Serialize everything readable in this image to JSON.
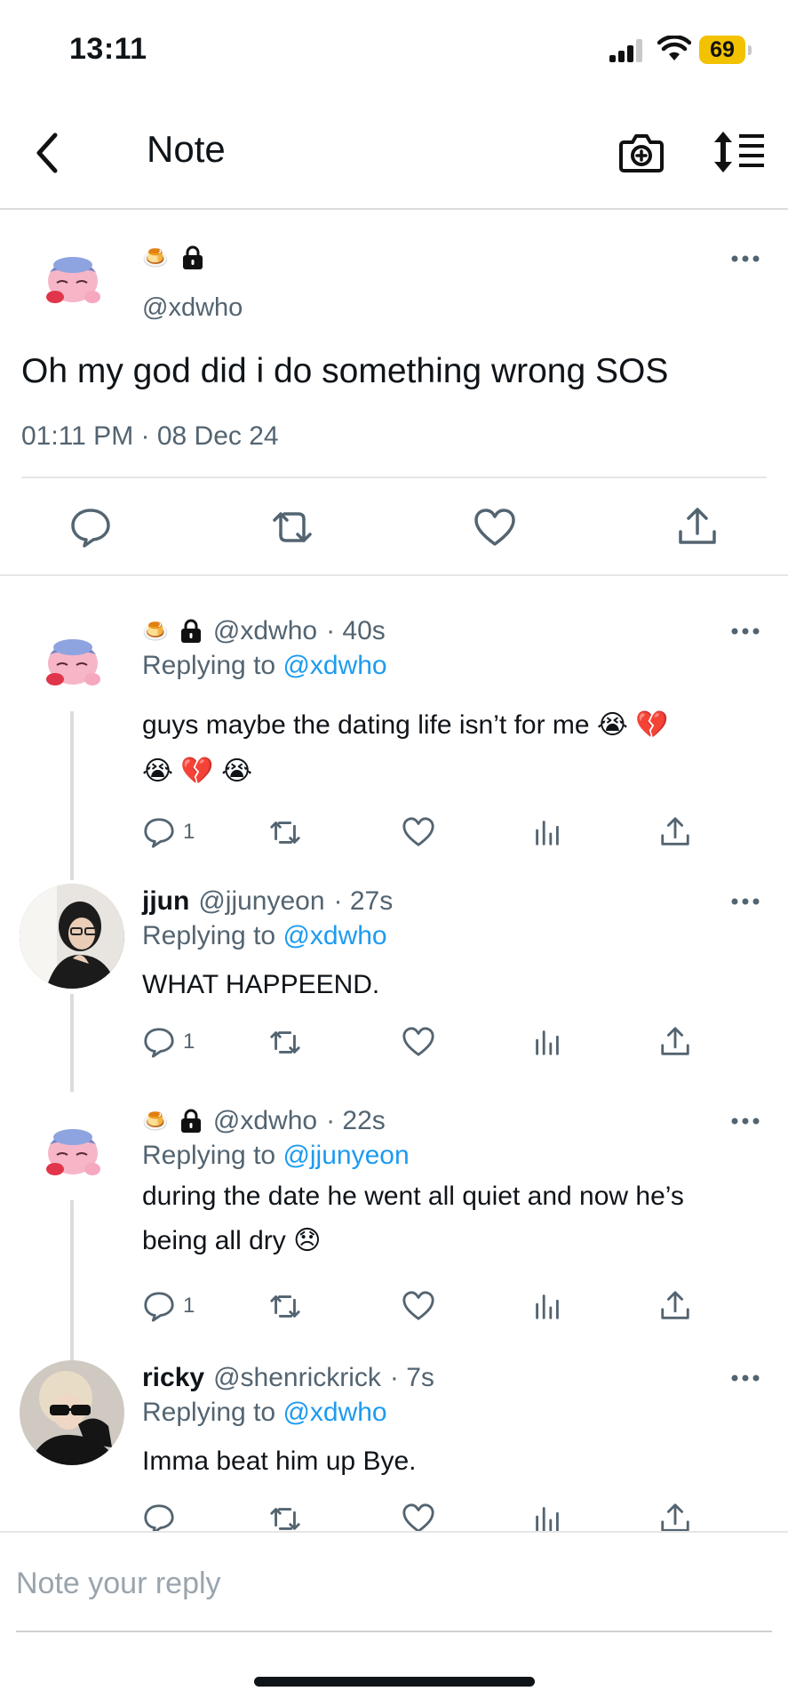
{
  "status_bar": {
    "time": "13:11",
    "battery": "69",
    "icons": [
      "signal-icon",
      "wifi-icon",
      "battery-icon"
    ],
    "battery_color": "#f2c200"
  },
  "header": {
    "title": "Note",
    "icons": [
      "back-arrow-icon",
      "camera-plus-icon",
      "sort-lines-icon"
    ]
  },
  "main_note": {
    "name_emoji": "🍮",
    "handle": "@xdwho",
    "text": "Oh my god did i do something wrong SOS",
    "timestamp": "01:11 PM · 08 Dec 24",
    "actions": [
      "reply-icon",
      "repost-icon",
      "like-icon",
      "share-icon"
    ]
  },
  "replies": [
    {
      "name_emoji": "🍮",
      "handle": "@xdwho",
      "time": "· 40s",
      "replying_prefix": "Replying to",
      "replying_to": "@xdwho",
      "text_line1": "guys maybe the dating life isn’t for me 😭 💔",
      "text_line2": "😭 💔 😭",
      "reply_count": "1"
    },
    {
      "name": "jjun",
      "handle": "@jjunyeon",
      "time": "· 27s",
      "replying_prefix": "Replying to",
      "replying_to": "@xdwho",
      "text": "WHAT HAPPEEND.",
      "reply_count": "1"
    },
    {
      "name_emoji": "🍮",
      "handle": "@xdwho",
      "time": "· 22s",
      "replying_prefix": "Replying to",
      "replying_to": "@jjunyeon",
      "text_line1": "during the date he went all quiet and now he’s",
      "text_line2": "being all dry 😞",
      "reply_count": "1"
    },
    {
      "name": "ricky",
      "handle": "@shenrickrick",
      "time": "· 7s",
      "replying_prefix": "Replying to",
      "replying_to": "@xdwho",
      "text": "Imma beat him up Bye."
    }
  ],
  "composer": {
    "placeholder": "Note your reply"
  },
  "colors": {
    "link": "#1d9bf0",
    "secondary_text": "#536471",
    "primary_text": "#0f1419"
  }
}
